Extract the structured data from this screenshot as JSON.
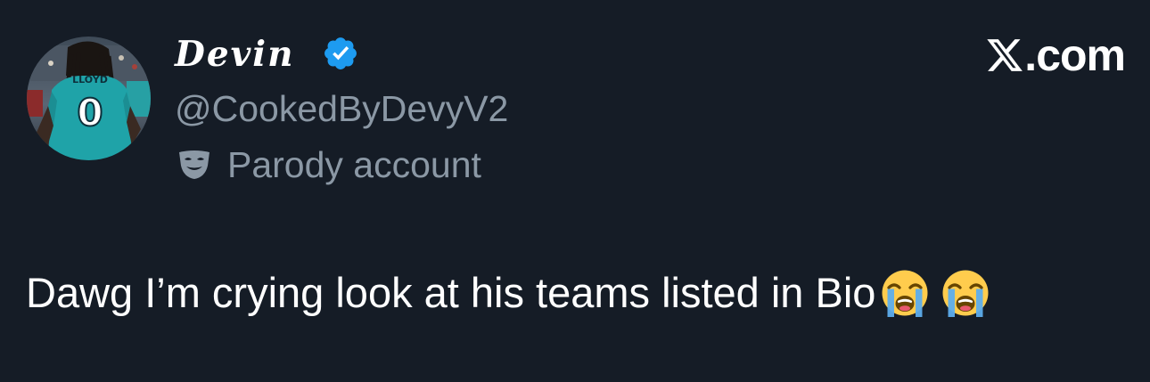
{
  "post": {
    "author": {
      "display_name": "Devin",
      "handle": "@CookedByDevyV2",
      "label": "Parody account",
      "verified": true,
      "avatar_jersey_name": "LLOYD",
      "avatar_jersey_number": "0"
    },
    "text": "Dawg I’m crying look at his teams listed in Bio",
    "emojis": [
      "loudly-crying-face",
      "loudly-crying-face"
    ]
  },
  "site": {
    "label": ".com",
    "icon": "x-logo-icon"
  },
  "colors": {
    "background": "#151c26",
    "primary_text": "#ffffff",
    "secondary_text": "#8b98a5",
    "verified_badge": "#1d9bf0"
  }
}
